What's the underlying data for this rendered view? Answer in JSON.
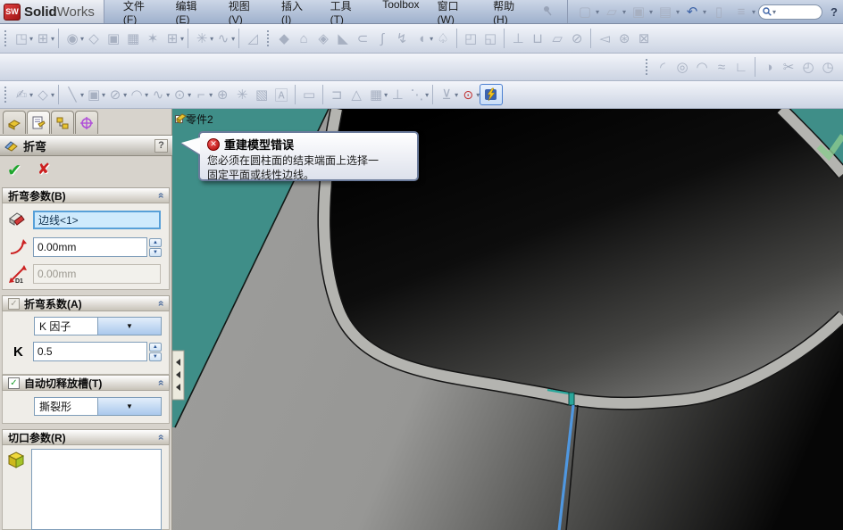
{
  "titlebar": {
    "logo_text": "SW",
    "brand_bold": "Solid",
    "brand_light": "Works",
    "menus": [
      "文件(F)",
      "编辑(E)",
      "视图(V)",
      "插入(I)",
      "工具(T)",
      "Toolbox",
      "窗口(W)",
      "帮助(H)"
    ],
    "help_mark": "?"
  },
  "viewport": {
    "tree_root_label": "零件2",
    "expand_glyph": "+",
    "error_tooltip": {
      "icon_glyph": "✕",
      "title": "重建模型错误",
      "line1": "您必须在圆柱面的结束端面上选择一",
      "line2": "固定平面或线性边线。"
    }
  },
  "panel": {
    "title": "折弯",
    "help_mark": "?",
    "ok_glyph": "✔",
    "cancel_glyph": "✘",
    "sections": {
      "bend_params": {
        "label": "折弯参数(B)",
        "edge_value": "边线<1>",
        "angle_value": "0.00mm",
        "distance_value": "0.00mm"
      },
      "bend_allowance": {
        "label": "折弯系数(A)",
        "checkbox_glyph": "✓",
        "type_value": "K 因子",
        "k_label": "K",
        "k_value": "0.5"
      },
      "auto_relief": {
        "label": "自动切释放槽(T)",
        "checkbox_glyph": "✓",
        "type_value": "撕裂形"
      },
      "rip_params": {
        "label": "切口参数(R)"
      }
    }
  },
  "colors": {
    "viewport_teal": "#3f8e88",
    "selection_blue": "#cfeafc",
    "rim_gray": "#b4b4b0",
    "selected_edge_blue": "#4f97e0",
    "error_red": "#c00000"
  }
}
